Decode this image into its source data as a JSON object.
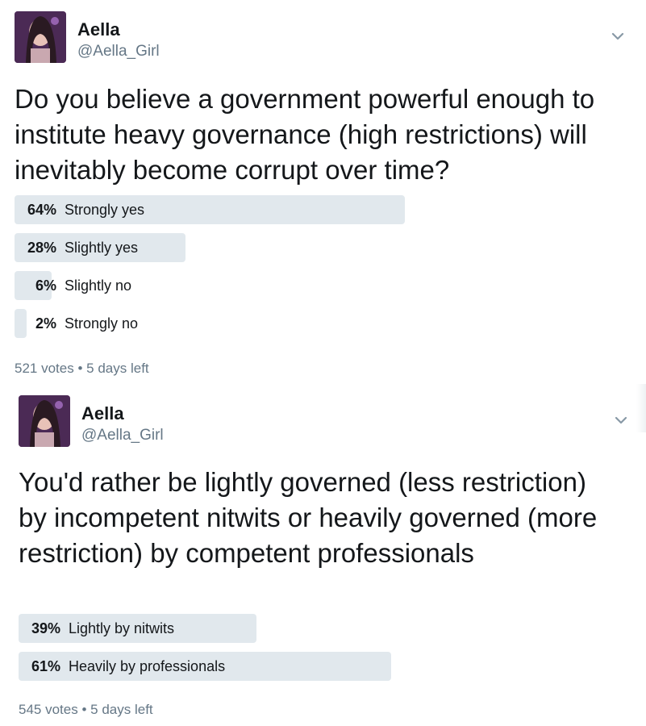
{
  "tweets": [
    {
      "author": {
        "name": "Aella",
        "handle": "@Aella_Girl"
      },
      "question": "Do you believe a government powerful enough to institute heavy governance (high restrictions) will inevitably become corrupt over time?",
      "options": [
        {
          "percent_label": "64%",
          "percent": 64,
          "label": "Strongly yes"
        },
        {
          "percent_label": "28%",
          "percent": 28,
          "label": "Slightly yes"
        },
        {
          "percent_label": "6%",
          "percent": 6,
          "label": "Slightly no"
        },
        {
          "percent_label": "2%",
          "percent": 2,
          "label": "Strongly no"
        }
      ],
      "votes": "521 votes",
      "separator": "•",
      "time_left": "5 days left"
    },
    {
      "author": {
        "name": "Aella",
        "handle": "@Aella_Girl"
      },
      "question": "You'd rather be lightly governed (less restriction) by incompetent nitwits or heavily governed (more restriction) by competent professionals",
      "options": [
        {
          "percent_label": "39%",
          "percent": 39,
          "label": "Lightly by nitwits"
        },
        {
          "percent_label": "61%",
          "percent": 61,
          "label": "Heavily by professionals"
        }
      ],
      "votes": "545 votes",
      "separator": "•",
      "time_left": "5 days left"
    }
  ],
  "icons": {
    "menu": "chevron-down-icon",
    "avatar": "avatar"
  },
  "colors": {
    "bar": "#e1e8ed",
    "text": "#14171a",
    "muted": "#657786"
  }
}
